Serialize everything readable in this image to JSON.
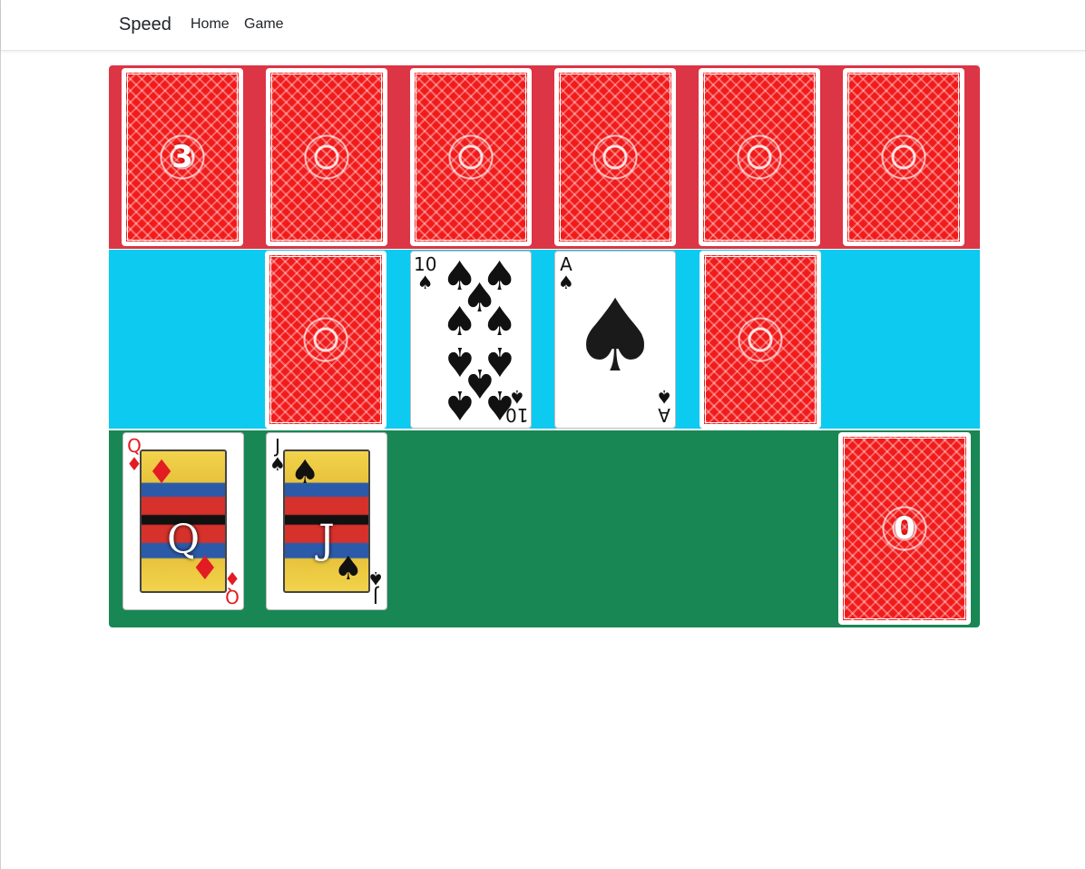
{
  "navbar": {
    "brand": "Speed",
    "links": [
      "Home",
      "Game"
    ]
  },
  "colors": {
    "opponent_row": "#dc3545",
    "center_row": "#0dcaf0",
    "player_row": "#198754",
    "card_back": "#f21b1b"
  },
  "opponent": {
    "draw_pile_count": "3",
    "hand": [
      {
        "face": "down",
        "label": "card-back"
      },
      {
        "face": "down",
        "label": "card-back"
      },
      {
        "face": "down",
        "label": "card-back"
      },
      {
        "face": "down",
        "label": "card-back"
      },
      {
        "face": "down",
        "label": "card-back"
      }
    ]
  },
  "center": {
    "left_spit_pile": {
      "face": "down"
    },
    "play_pile_left": {
      "rank": "10",
      "suit": "♠",
      "color": "black"
    },
    "play_pile_right": {
      "rank": "A",
      "suit": "♠",
      "color": "black"
    },
    "right_spit_pile": {
      "face": "down"
    }
  },
  "player": {
    "hand": [
      {
        "rank": "Q",
        "suit": "♦",
        "color": "red",
        "court_letter": "Q"
      },
      {
        "rank": "J",
        "suit": "♠",
        "color": "black",
        "court_letter": "J"
      }
    ],
    "draw_pile_count": "0"
  }
}
